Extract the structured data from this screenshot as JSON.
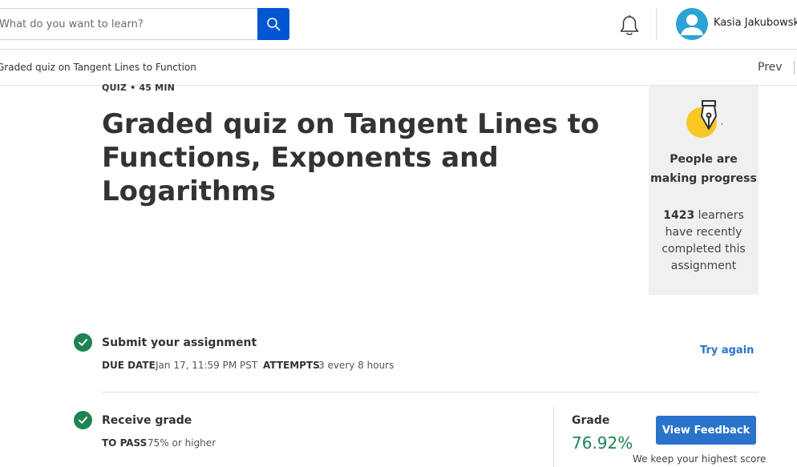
{
  "header": {
    "search_placeholder": "What do you want to learn?",
    "user_name": "Kasia Jakubowska"
  },
  "subheader": {
    "breadcrumb": "Graded quiz on Tangent Lines to Functions, Exponents",
    "prev_label": "Prev"
  },
  "main": {
    "quiz_meta": "QUIZ • 45 MIN",
    "title": "Graded quiz on Tangent Lines to Functions, Exponents and Logarithms"
  },
  "progress_card": {
    "heading": "People are making progress",
    "learner_count": "1423",
    "body_text": " learners have recently completed this assignment",
    "dot": ","
  },
  "submit_row": {
    "title": "Submit your assignment",
    "due_label": "DUE DATE",
    "due_value": "Jan 17, 11:59 PM PST",
    "attempts_label": "ATTEMPTS",
    "attempts_value": "3 every 8 hours",
    "try_again_label": "Try again"
  },
  "grade_row": {
    "title": "Receive grade",
    "pass_label": "TO PASS",
    "pass_value": "75% or higher",
    "grade_label": "Grade",
    "grade_value": "76.92%",
    "view_feedback_label": "View Feedback",
    "keep_note": "We keep your highest score"
  },
  "colors": {
    "primary_blue": "#0056d2",
    "link_blue": "#2a73cc",
    "success_green": "#1f8354",
    "avatar_blue": "#2ba3d5",
    "badge_yellow": "#f7c825"
  },
  "icons": [
    "search-icon",
    "bell-icon",
    "user-avatar-icon",
    "pen-nib-icon",
    "check-circle-icon"
  ]
}
